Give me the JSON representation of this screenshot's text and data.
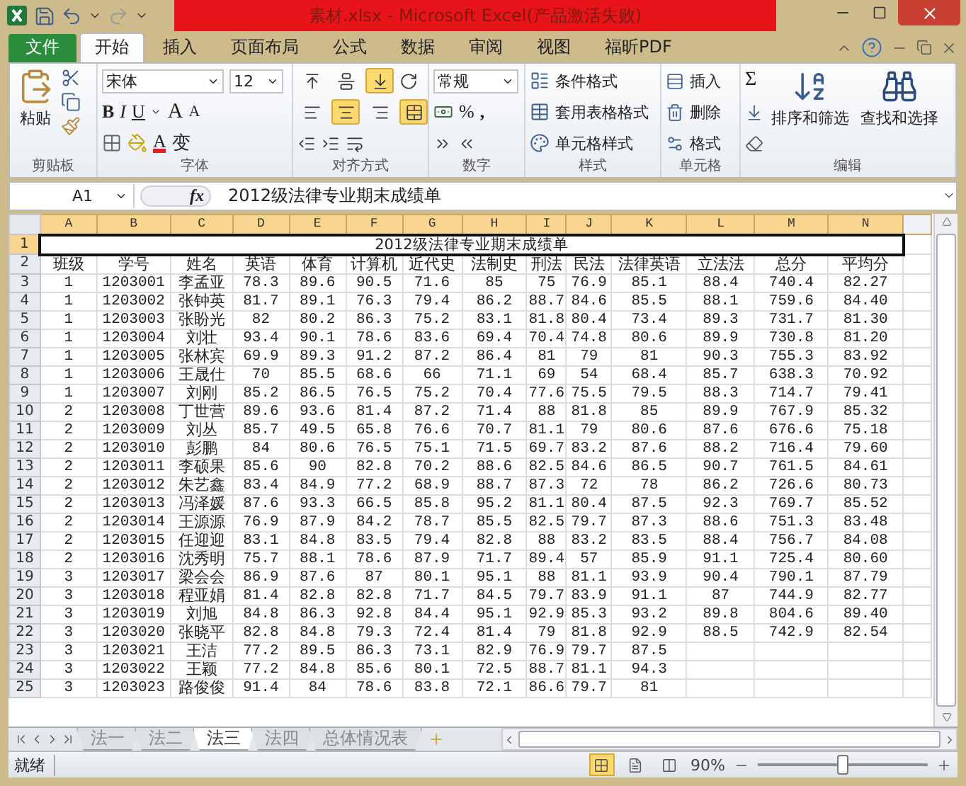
{
  "window": {
    "title": "素材.xlsx - Microsoft Excel(产品激活失败)"
  },
  "ribbon": {
    "file_tab": "文件",
    "tabs": [
      {
        "label": "开始",
        "selected": true
      },
      {
        "label": "插入",
        "selected": false
      },
      {
        "label": "页面布局",
        "selected": false
      },
      {
        "label": "公式",
        "selected": false
      },
      {
        "label": "数据",
        "selected": false
      },
      {
        "label": "审阅",
        "selected": false
      },
      {
        "label": "视图",
        "selected": false
      },
      {
        "label": "福昕PDF",
        "selected": false
      }
    ],
    "clipboard": {
      "label": "剪贴板",
      "paste": "粘贴"
    },
    "font": {
      "label": "字体",
      "name": "宋体",
      "size": "12",
      "bold": "B",
      "italic": "I",
      "underline": "U",
      "grow": "A",
      "shrink": "A",
      "font_color_letter": "A",
      "phonetic": "变"
    },
    "alignment": {
      "label": "对齐方式",
      "valign": [
        {
          "selected": false
        },
        {
          "selected": false
        },
        {
          "selected": true
        }
      ],
      "halign": [
        {
          "selected": false
        },
        {
          "selected": true
        },
        {
          "selected": false
        }
      ],
      "merge": {
        "selected": true
      }
    },
    "number": {
      "label": "数字",
      "format": "常规",
      "percent": "%",
      "comma": ","
    },
    "styles": {
      "label": "样式",
      "items": [
        "条件格式",
        "套用表格格式",
        "单元格样式"
      ]
    },
    "cells": {
      "label": "单元格",
      "items": [
        "插入",
        "删除",
        "格式"
      ]
    },
    "editing": {
      "label": "编辑",
      "sum": "Σ",
      "sort": "排序和筛选",
      "find": "查找和选择"
    }
  },
  "formula_bar": {
    "name_box": "A1",
    "fx": "fx",
    "content": "2012级法律专业期末成绩单"
  },
  "sheet": {
    "columns": [
      {
        "label": "A",
        "selected": true
      },
      {
        "label": "B",
        "selected": true
      },
      {
        "label": "C",
        "selected": true
      },
      {
        "label": "D",
        "selected": true
      },
      {
        "label": "E",
        "selected": true
      },
      {
        "label": "F",
        "selected": true
      },
      {
        "label": "G",
        "selected": true
      },
      {
        "label": "H",
        "selected": true
      },
      {
        "label": "I",
        "selected": true
      },
      {
        "label": "J",
        "selected": true
      },
      {
        "label": "K",
        "selected": true
      },
      {
        "label": "L",
        "selected": true
      },
      {
        "label": "M",
        "selected": true
      },
      {
        "label": "N",
        "selected": true
      }
    ],
    "title_row": {
      "row": "1",
      "text": "2012级法律专业期末成绩单",
      "selected": true
    },
    "header_row": {
      "row": "2",
      "cells": [
        "班级",
        "学号",
        "姓名",
        "英语",
        "体育",
        "计算机",
        "近代史",
        "法制史",
        "刑法",
        "民法",
        "法律英语",
        "立法法",
        "总分",
        "平均分"
      ]
    },
    "rows": [
      {
        "row": "3",
        "cells": [
          "1",
          "1203001",
          "李孟亚",
          "78.3",
          "89.6",
          "90.5",
          "71.6",
          "85",
          "75",
          "76.9",
          "85.1",
          "88.4",
          "740.4",
          "82.27"
        ]
      },
      {
        "row": "4",
        "cells": [
          "1",
          "1203002",
          "张钟英",
          "81.7",
          "89.1",
          "76.3",
          "79.4",
          "86.2",
          "88.7",
          "84.6",
          "85.5",
          "88.1",
          "759.6",
          "84.40"
        ]
      },
      {
        "row": "5",
        "cells": [
          "1",
          "1203003",
          "张盼光",
          "82",
          "80.2",
          "86.3",
          "75.2",
          "83.1",
          "81.8",
          "80.4",
          "73.4",
          "89.3",
          "731.7",
          "81.30"
        ]
      },
      {
        "row": "6",
        "cells": [
          "1",
          "1203004",
          "刘壮",
          "93.4",
          "90.1",
          "78.6",
          "83.6",
          "69.4",
          "70.4",
          "74.8",
          "80.6",
          "89.9",
          "730.8",
          "81.20"
        ]
      },
      {
        "row": "7",
        "cells": [
          "1",
          "1203005",
          "张林宾",
          "69.9",
          "89.3",
          "91.2",
          "87.2",
          "86.4",
          "81",
          "79",
          "81",
          "90.3",
          "755.3",
          "83.92"
        ]
      },
      {
        "row": "8",
        "cells": [
          "1",
          "1203006",
          "王晟仕",
          "70",
          "85.5",
          "68.6",
          "66",
          "71.1",
          "69",
          "54",
          "68.4",
          "85.7",
          "638.3",
          "70.92"
        ]
      },
      {
        "row": "9",
        "cells": [
          "1",
          "1203007",
          "刘刚",
          "85.2",
          "86.5",
          "76.5",
          "75.2",
          "70.4",
          "77.6",
          "75.5",
          "79.5",
          "88.3",
          "714.7",
          "79.41"
        ]
      },
      {
        "row": "10",
        "cells": [
          "2",
          "1203008",
          "丁世营",
          "89.6",
          "93.6",
          "81.4",
          "87.2",
          "71.4",
          "88",
          "81.8",
          "85",
          "89.9",
          "767.9",
          "85.32"
        ]
      },
      {
        "row": "11",
        "cells": [
          "2",
          "1203009",
          "刘丛",
          "85.7",
          "49.5",
          "65.8",
          "76.6",
          "70.7",
          "81.1",
          "79",
          "80.6",
          "87.6",
          "676.6",
          "75.18"
        ]
      },
      {
        "row": "12",
        "cells": [
          "2",
          "1203010",
          "彭鹏",
          "84",
          "80.6",
          "76.5",
          "75.1",
          "71.5",
          "69.7",
          "83.2",
          "87.6",
          "88.2",
          "716.4",
          "79.60"
        ]
      },
      {
        "row": "13",
        "cells": [
          "2",
          "1203011",
          "李硕果",
          "85.6",
          "90",
          "82.8",
          "70.2",
          "88.6",
          "82.5",
          "84.6",
          "86.5",
          "90.7",
          "761.5",
          "84.61"
        ]
      },
      {
        "row": "14",
        "cells": [
          "2",
          "1203012",
          "朱艺鑫",
          "83.4",
          "84.9",
          "77.2",
          "68.9",
          "88.7",
          "87.3",
          "72",
          "78",
          "86.2",
          "726.6",
          "80.73"
        ]
      },
      {
        "row": "15",
        "cells": [
          "2",
          "1203013",
          "冯泽媛",
          "87.6",
          "93.3",
          "66.5",
          "85.8",
          "95.2",
          "81.1",
          "80.4",
          "87.5",
          "92.3",
          "769.7",
          "85.52"
        ]
      },
      {
        "row": "16",
        "cells": [
          "2",
          "1203014",
          "王源源",
          "76.9",
          "87.9",
          "84.2",
          "78.7",
          "85.5",
          "82.5",
          "79.7",
          "87.3",
          "88.6",
          "751.3",
          "83.48"
        ]
      },
      {
        "row": "17",
        "cells": [
          "2",
          "1203015",
          "任迎迎",
          "83.1",
          "84.8",
          "83.5",
          "79.4",
          "82.8",
          "88",
          "83.2",
          "83.5",
          "88.4",
          "756.7",
          "84.08"
        ]
      },
      {
        "row": "18",
        "cells": [
          "2",
          "1203016",
          "沈秀明",
          "75.7",
          "88.1",
          "78.6",
          "87.9",
          "71.7",
          "89.4",
          "57",
          "85.9",
          "91.1",
          "725.4",
          "80.60"
        ]
      },
      {
        "row": "19",
        "cells": [
          "3",
          "1203017",
          "梁会会",
          "86.9",
          "87.6",
          "87",
          "80.1",
          "95.1",
          "88",
          "81.1",
          "93.9",
          "90.4",
          "790.1",
          "87.79"
        ]
      },
      {
        "row": "20",
        "cells": [
          "3",
          "1203018",
          "程亚娟",
          "81.4",
          "82.8",
          "82.8",
          "71.7",
          "84.5",
          "79.7",
          "83.9",
          "91.1",
          "87",
          "744.9",
          "82.77"
        ]
      },
      {
        "row": "21",
        "cells": [
          "3",
          "1203019",
          "刘旭",
          "84.8",
          "86.3",
          "92.8",
          "84.4",
          "95.1",
          "92.9",
          "85.3",
          "93.2",
          "89.8",
          "804.6",
          "89.40"
        ]
      },
      {
        "row": "22",
        "cells": [
          "3",
          "1203020",
          "张晓平",
          "82.8",
          "84.8",
          "79.3",
          "72.4",
          "81.4",
          "79",
          "81.8",
          "92.9",
          "88.5",
          "742.9",
          "82.54"
        ]
      },
      {
        "row": "23",
        "cells": [
          "3",
          "1203021",
          "王洁",
          "77.2",
          "89.5",
          "86.3",
          "73.1",
          "82.9",
          "76.9",
          "79.7",
          "87.5"
        ]
      },
      {
        "row": "24",
        "cells": [
          "3",
          "1203022",
          "王颖",
          "77.2",
          "84.8",
          "85.6",
          "80.1",
          "72.5",
          "88.7",
          "81.1",
          "94.3"
        ]
      },
      {
        "row": "25",
        "cells": [
          "3",
          "1203023",
          "路俊俊",
          "91.4",
          "84",
          "78.6",
          "83.8",
          "72.1",
          "86.6",
          "79.7",
          "81"
        ]
      }
    ]
  },
  "sheet_tabs": [
    {
      "label": "法一",
      "selected": false
    },
    {
      "label": "法二",
      "selected": false
    },
    {
      "label": "法三",
      "selected": true
    },
    {
      "label": "法四",
      "selected": false
    },
    {
      "label": "总体情况表",
      "selected": false
    }
  ],
  "status_bar": {
    "status": "就绪",
    "views": [
      {
        "selected": true
      },
      {
        "selected": false
      },
      {
        "selected": false
      }
    ],
    "zoom": "90%",
    "zoom_slider": {
      "level": 0.5
    }
  }
}
